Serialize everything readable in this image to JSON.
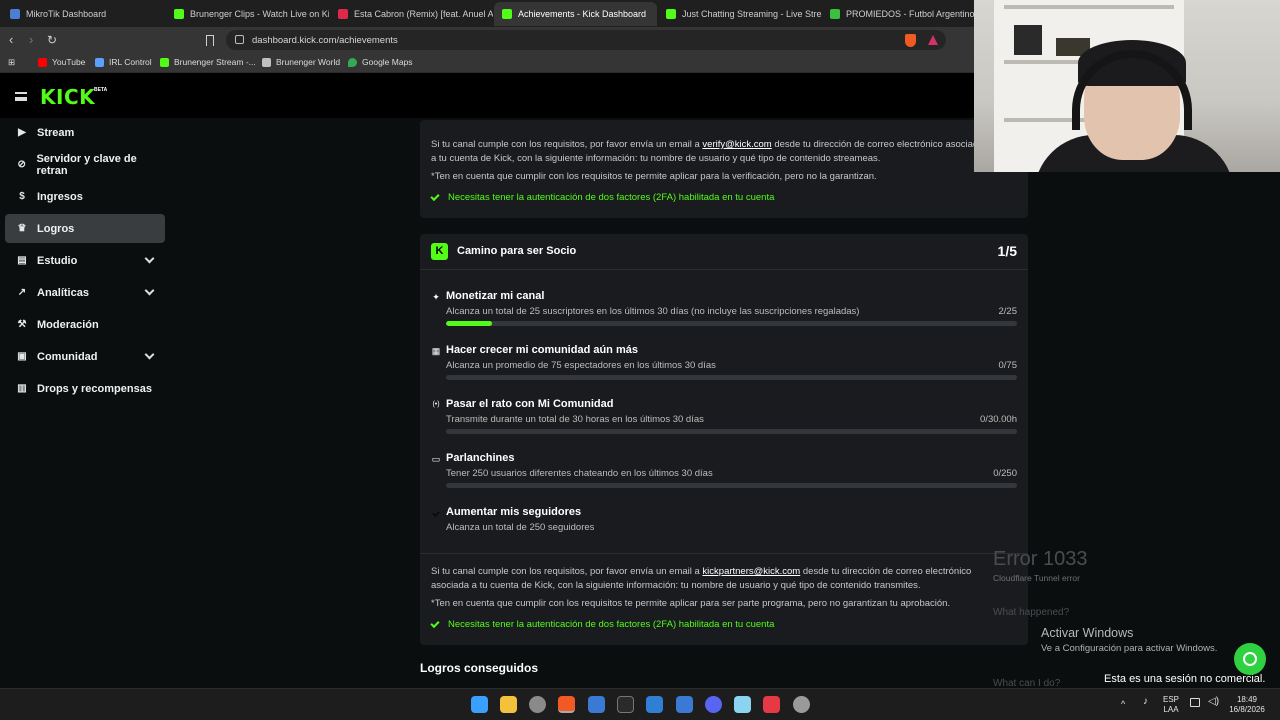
{
  "browser": {
    "tabs": [
      {
        "label": "MikroTik Dashboard",
        "color": "#4a7fd4"
      },
      {
        "label": "Brunenger Clips - Watch Live on Kick",
        "color": "#53fc18"
      },
      {
        "label": "Esta Cabron (Remix) [feat. Anuel AA",
        "color": "#e0284a"
      },
      {
        "label": "Achievements - Kick Dashboard",
        "color": "#53fc18"
      },
      {
        "label": "Just Chatting Streaming - Live Stream",
        "color": "#53fc18"
      },
      {
        "label": "PROMIEDOS - Futbol Argentino - Fix",
        "color": "#3cbf3c"
      }
    ],
    "close_glyph": "✕",
    "url": "dashboard.kick.com/achievements",
    "bookmarks": [
      {
        "label": "YouTube",
        "color": "#ff0000"
      },
      {
        "label": "IRL Control",
        "color": "#5aa0ff"
      },
      {
        "label": "Brunenger Stream -...",
        "color": "#53fc18"
      },
      {
        "label": "Brunenger World",
        "color": "#c0c0c0"
      },
      {
        "label": "Google Maps",
        "color": "#34a853"
      }
    ]
  },
  "kick": {
    "logo": "KICK",
    "logo_badge": "BETA",
    "sidebar": [
      {
        "label": "Stream",
        "icon": "video-icon",
        "glyph": "▶"
      },
      {
        "label": "Servidor y clave de retran",
        "icon": "link-icon",
        "glyph": "⊘"
      },
      {
        "label": "Ingresos",
        "icon": "money-icon",
        "glyph": "$"
      },
      {
        "label": "Logros",
        "icon": "trophy-icon",
        "glyph": "♛"
      },
      {
        "label": "Estudio",
        "icon": "layers-icon",
        "glyph": "▤"
      },
      {
        "label": "Analíticas",
        "icon": "chart-icon",
        "glyph": "↗"
      },
      {
        "label": "Moderación",
        "icon": "wrench-icon",
        "glyph": "⚒"
      },
      {
        "label": "Comunidad",
        "icon": "chat-icon",
        "glyph": "▣"
      },
      {
        "label": "Drops y recompensas",
        "icon": "gift-chart-icon",
        "glyph": "▥"
      }
    ],
    "verify_card": {
      "line1_pre": "Si tu canal cumple con los requisitos, por favor envía un email a ",
      "line1_link": "verify@kick.com",
      "line1_post": " desde tu dirección de correo electrónico asociada a",
      "line2": "a tu cuenta de Kick, con la siguiente información: tu nombre de usuario y qué tipo de contenido streameas.",
      "note": "*Ten en cuenta que cumplir con los requisitos te permite aplicar para la verificación, pero no la garantizan.",
      "check": "Necesitas tener la autenticación de dos factores (2FA) habilitada en tu cuenta"
    },
    "partner_card": {
      "title": "Camino para ser Socio",
      "count": "1/5",
      "achievements": [
        {
          "title": "Monetizar mi canal",
          "desc": "Alcanza un total de 25 suscriptores en los últimos 30 días (no incluye las suscripciones regaladas)",
          "progress": "2/25",
          "fraction": 0.08,
          "icon": "sparkle-icon",
          "glyph": "✦"
        },
        {
          "title": "Hacer crecer mi comunidad aún más",
          "desc": "Alcanza un promedio de 75 espectadores en los últimos 30 días",
          "progress": "0/75",
          "fraction": 0,
          "icon": "people-icon",
          "glyph": "▦"
        },
        {
          "title": "Pasar el rato con Mi Comunidad",
          "desc": "Transmite durante un total de 30 horas en los últimos 30 días",
          "progress": "0/30.00h",
          "fraction": 0,
          "icon": "broadcast-icon",
          "glyph": "(•)"
        },
        {
          "title": "Parlanchines",
          "desc": "Tener 250 usuarios diferentes chateando en los últimos 30 días",
          "progress": "0/250",
          "fraction": 0,
          "icon": "chat-icon",
          "glyph": "▭"
        },
        {
          "title": "Aumentar mis seguidores",
          "desc": "Alcanza un total de 250 seguidores",
          "progress": "",
          "fraction": 1,
          "icon": "check-circle-icon",
          "glyph": ""
        }
      ],
      "line1_pre": "Si tu canal cumple con los requisitos, por favor envía un email a ",
      "line1_link": "kickpartners@kick.com",
      "line1_post": " desde tu dirección de correo electrónico",
      "line2": "asociada a tu cuenta de Kick, con la siguiente información: tu nombre de usuario y qué tipo de contenido transmites.",
      "note": "*Ten en cuenta que cumplir con los requisitos te permite aplicar para ser parte programa, pero no garantizan tu aprobación.",
      "check": "Necesitas tener la autenticación de dos factores (2FA) habilitada en tu cuenta"
    },
    "earned_heading": "Logros conseguidos"
  },
  "overlay": {
    "error_title": "Error 1033",
    "error_sub": "Cloudflare Tunnel error",
    "what_happened": "What happened?",
    "what_can": "What can I do?",
    "activate_title": "Activar Windows",
    "activate_sub": "Ve a Configuración para activar Windows.",
    "session": "Esta es una sesión no comercial."
  },
  "taskbar": {
    "lang_top": "ESP",
    "lang_bottom": "LAA",
    "time": "18:49",
    "date": "16/8/2026",
    "apps": [
      {
        "name": "start-icon",
        "color": "#3aa0ff"
      },
      {
        "name": "file-explorer-icon",
        "color": "#f3c13a"
      },
      {
        "name": "chrome-icon",
        "color": "#8a8a8a"
      },
      {
        "name": "brave-icon",
        "color": "#f25a24"
      },
      {
        "name": "app-icon",
        "color": "#3a7ad4"
      },
      {
        "name": "terminal-icon",
        "color": "#2a2a2a"
      },
      {
        "name": "vscode-icon",
        "color": "#2f80d4"
      },
      {
        "name": "app-icon",
        "color": "#3a7ad4"
      },
      {
        "name": "discord-icon",
        "color": "#5865f2"
      },
      {
        "name": "notepad-icon",
        "color": "#8ad4f0"
      },
      {
        "name": "anydesk-icon",
        "color": "#e63946"
      },
      {
        "name": "settings-icon",
        "color": "#9a9a9a"
      }
    ]
  }
}
